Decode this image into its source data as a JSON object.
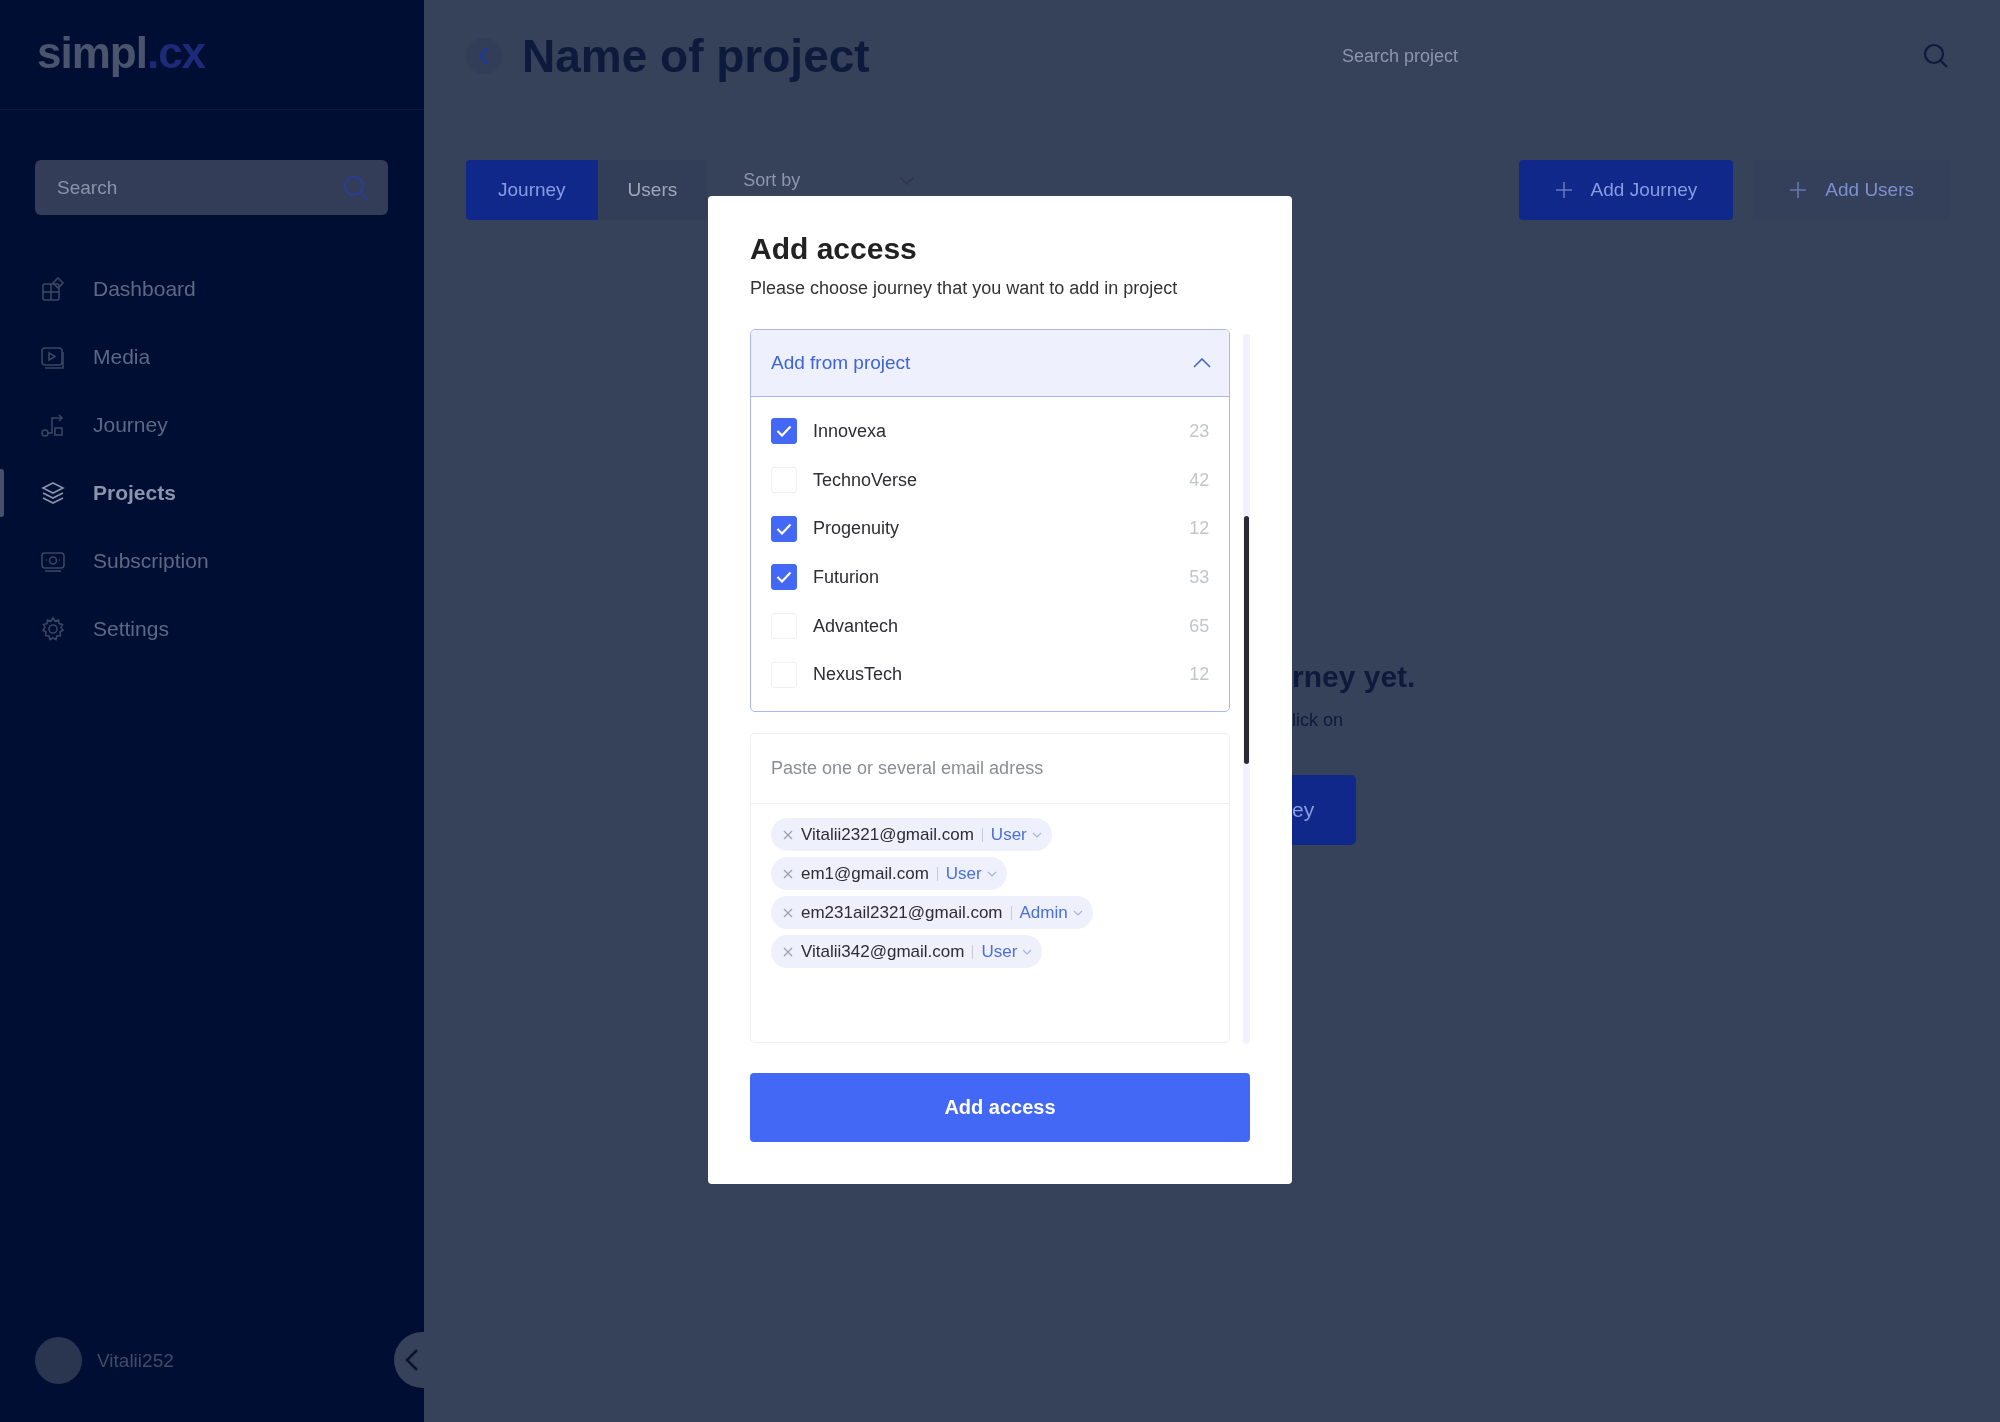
{
  "sidebar": {
    "logo": {
      "main": "simpl",
      "accent": ".cx"
    },
    "search": {
      "placeholder": "Search"
    },
    "items": [
      {
        "label": "Dashboard",
        "kind": "dashboard",
        "selected": false
      },
      {
        "label": "Media",
        "kind": "media",
        "selected": false
      },
      {
        "label": "Journey",
        "kind": "journey",
        "selected": false
      },
      {
        "label": "Projects",
        "kind": "projects",
        "selected": true
      },
      {
        "label": "Subscription",
        "kind": "subscription",
        "selected": false
      },
      {
        "label": "Settings",
        "kind": "settings",
        "selected": false
      }
    ],
    "user": {
      "name": "Vitalii252"
    }
  },
  "header": {
    "title": "Name of project",
    "search": {
      "placeholder": "Search project"
    }
  },
  "tabs": [
    {
      "label": "Journey",
      "selected": true
    },
    {
      "label": "Users",
      "selected": false
    }
  ],
  "sort": {
    "label": "Sort by"
  },
  "actions": [
    {
      "label": "Add Journey",
      "disabled": false
    },
    {
      "label": "Add Users",
      "disabled": true
    }
  ],
  "empty_state": {
    "title": "rney yet.",
    "text": "lick on",
    "button": "ey"
  },
  "modal": {
    "title": "Add access",
    "subtitle": "Please choose journey that you want to add in project",
    "dropdown": {
      "label": "Add from project",
      "expanded": true,
      "items": [
        {
          "name": "Innovexa",
          "count": "23",
          "checked": true
        },
        {
          "name": "TechnoVerse",
          "count": "42",
          "checked": false
        },
        {
          "name": "Progenuity",
          "count": "12",
          "checked": true
        },
        {
          "name": "Futurion",
          "count": "53",
          "checked": true
        },
        {
          "name": "Advantech",
          "count": "65",
          "checked": false
        },
        {
          "name": "NexusTech",
          "count": "12",
          "checked": false
        }
      ]
    },
    "emails": {
      "placeholder": "Paste one or several email adress",
      "chips": [
        {
          "email": "Vitalii2321@gmail.com",
          "role": "User"
        },
        {
          "email": "em1@gmail.com",
          "role": "User"
        },
        {
          "email": "em231ail2321@gmail.com",
          "role": "Admin"
        },
        {
          "email": "Vitalii342@gmail.com",
          "role": "User"
        }
      ]
    },
    "button": "Add access"
  }
}
